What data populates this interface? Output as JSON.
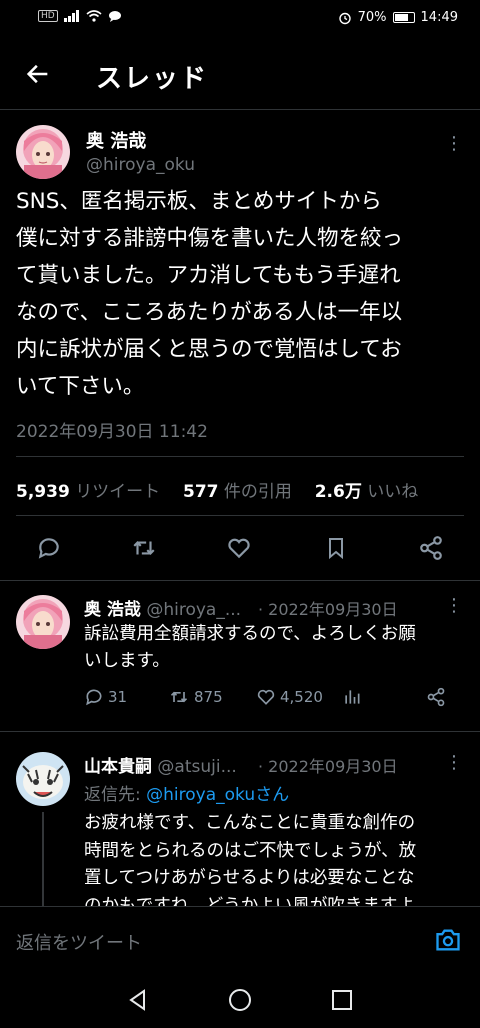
{
  "status_bar": {
    "hd": "HD",
    "battery": "70%",
    "battery_level": 0.7,
    "time": "14:49"
  },
  "header": {
    "title": "スレッド"
  },
  "main_tweet": {
    "name": "奥 浩哉",
    "handle": "@hiroya_oku",
    "lines": [
      "SNS、匿名掲示板、まとめサイトから",
      "僕に対する誹謗中傷を書いた人物を絞っ",
      "て貰いました。アカ消してももう手遅れ",
      "なので、こころあたりがある人は一年以",
      "内に訴状が届くと思うので覚悟はしてお",
      "いて下さい。"
    ],
    "timestamp": "2022年09月30日 11:42",
    "retweets_count": "5,939",
    "retweets_label": "リツイート",
    "quotes_count": "577",
    "quotes_label": "件の引用",
    "likes_count": "2.6万",
    "likes_label": "いいね"
  },
  "reply1": {
    "name": "奥 浩哉",
    "handle": "@hiroya_...",
    "date": "· 2022年09月30日",
    "lines": [
      "訴訟費用全額請求するので、よろしくお願",
      "いします。"
    ],
    "replies": "31",
    "retweets": "875",
    "likes": "4,520"
  },
  "reply2": {
    "name": "山本貴嗣",
    "handle": "@atsuji...",
    "date": "· 2022年09月30日",
    "reply_to_label": "返信先: ",
    "reply_to_handle": "@hiroya_oku",
    "reply_to_suffix": "さん",
    "lines": [
      "お疲れ様です、こんなことに貴重な創作の",
      "時間をとられるのはご不快でしょうが、放",
      "置してつけあがらせるよりは必要なことな",
      "のかもですね。どうかよい風が吹きますよ"
    ]
  },
  "compose": {
    "placeholder": "返信をツイート"
  },
  "colors": {
    "link": "#1d9bf0",
    "background": "#000000",
    "muted": "#71767b"
  }
}
